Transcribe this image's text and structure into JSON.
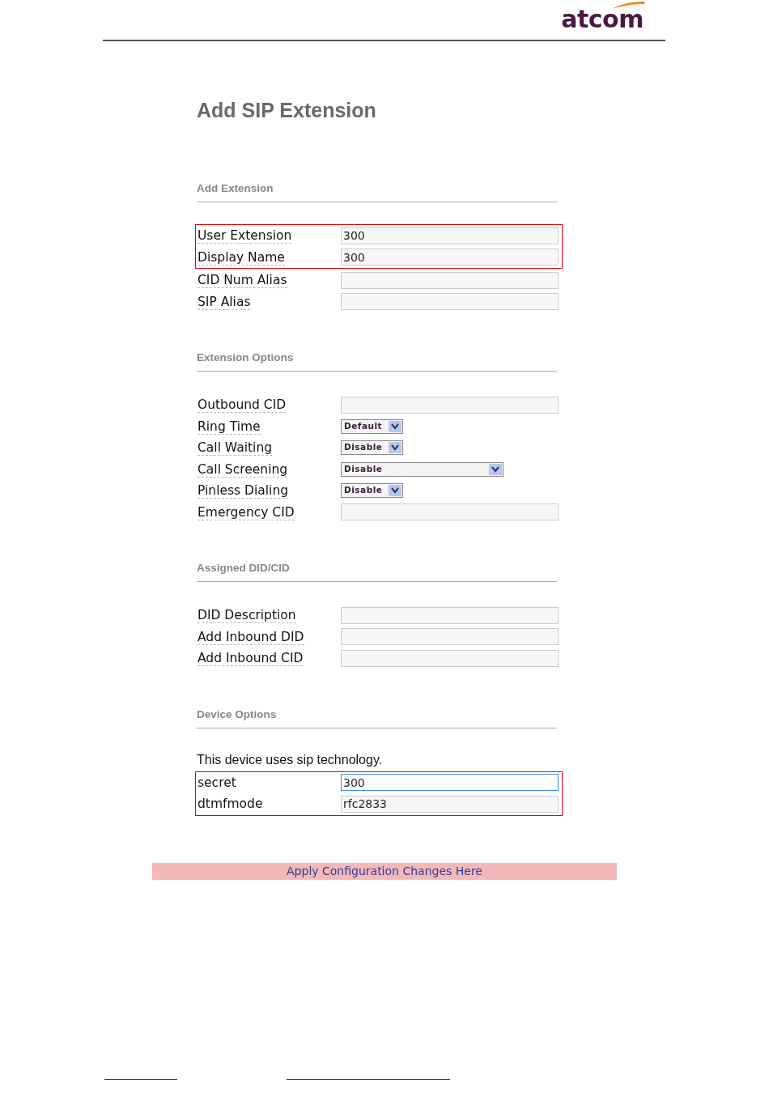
{
  "header": {
    "logo": "atcom"
  },
  "title": "Add SIP Extension",
  "sections": [
    {
      "heading": "Add Extension",
      "help_labels": true,
      "groups": [
        {
          "highlighted": true,
          "fields": [
            {
              "label": "User Extension",
              "kind": "text",
              "value": "300"
            },
            {
              "label": "Display Name",
              "kind": "text",
              "value": "300"
            }
          ]
        },
        {
          "highlighted": false,
          "fields": [
            {
              "label": "CID Num Alias",
              "kind": "text"
            },
            {
              "label": "SIP Alias",
              "kind": "text"
            }
          ]
        }
      ]
    },
    {
      "heading": "Extension Options",
      "help_labels": true,
      "groups": [
        {
          "highlighted": false,
          "fields": [
            {
              "label": "Outbound CID",
              "kind": "text"
            },
            {
              "label": "Ring Time",
              "kind": "select",
              "value": "Default",
              "wide": false
            },
            {
              "label": "Call Waiting",
              "kind": "select",
              "value": "Disable",
              "wide": false
            },
            {
              "label": "Call Screening",
              "kind": "select",
              "value": "Disable",
              "wide": true
            },
            {
              "label": "Pinless Dialing",
              "kind": "select",
              "value": "Disable",
              "wide": false
            },
            {
              "label": "Emergency CID",
              "kind": "text"
            }
          ]
        }
      ]
    },
    {
      "heading": "Assigned DID/CID",
      "help_labels": true,
      "groups": [
        {
          "highlighted": false,
          "fields": [
            {
              "label": "DID Description",
              "kind": "text"
            },
            {
              "label": "Add Inbound DID",
              "kind": "text"
            },
            {
              "label": "Add Inbound CID",
              "kind": "text"
            }
          ]
        }
      ]
    },
    {
      "heading": "Device Options",
      "help_labels": false,
      "note": "This device uses sip technology.",
      "groups": [
        {
          "highlighted": true,
          "fields": [
            {
              "label": "secret",
              "kind": "text",
              "value": "300",
              "focused": true
            },
            {
              "label": "dtmfmode",
              "kind": "text",
              "value": "rfc2833",
              "focused": false
            }
          ]
        }
      ]
    }
  ],
  "apply_button": "Apply Configuration Changes Here"
}
